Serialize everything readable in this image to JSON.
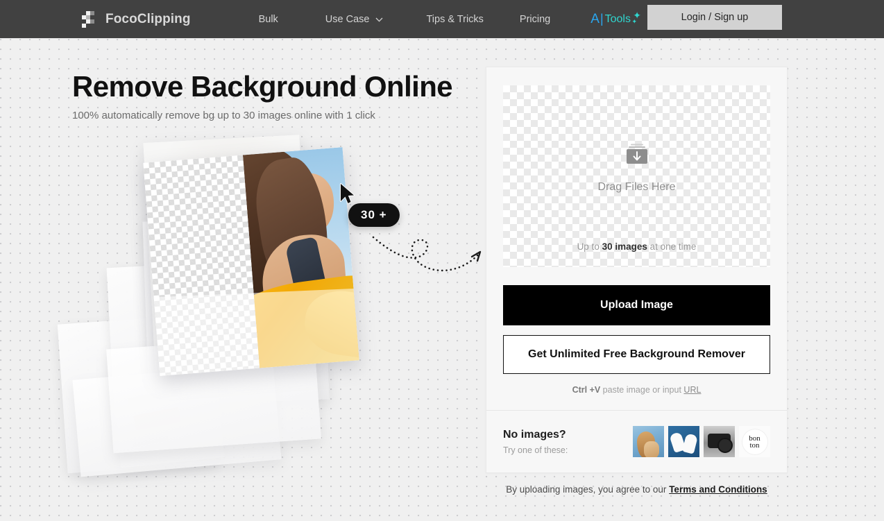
{
  "header": {
    "brand": "FocoClipping",
    "logo_icon": "checkerboard-logo-icon",
    "nav": [
      {
        "label": "Bulk",
        "icon": null
      },
      {
        "label": "Use Case",
        "icon": "chevron-down-icon"
      },
      {
        "label": "Tips & Tricks",
        "icon": null
      },
      {
        "label": "Pricing",
        "icon": null
      }
    ],
    "ai_tools": {
      "a": "A",
      "bar": "|",
      "word": "Tools",
      "spark_small": "✦",
      "spark_large": "✦"
    },
    "login_label": "Login / Sign up",
    "bar_color": "#414141",
    "accent_cyan": "#2fd6cf",
    "accent_blue": "#2aa7f0"
  },
  "hero": {
    "title": "Remove Background Online",
    "subtitle": "100% automatically remove bg up to 30 images online with 1 click",
    "badge": "30 +",
    "cursor_icon": "mouse-pointer-icon",
    "arrow_icon": "dotted-curved-arrow-icon"
  },
  "panel": {
    "dropzone": {
      "icon": "upload-tray-icon",
      "label": "Drag Files Here",
      "limit_prefix": "Up to ",
      "limit_strong": "30 images",
      "limit_suffix": " at one time"
    },
    "primary_button": "Upload Image",
    "secondary_button": "Get Unlimited Free Background Remover",
    "paste_hint": {
      "shortcut": "Ctrl +V",
      "text": " paste image or input ",
      "link": "URL"
    },
    "no_images": {
      "title": "No images?",
      "subtitle": "Try one of these:",
      "thumbs": [
        {
          "name": "sample-woman-sunglasses"
        },
        {
          "name": "sample-sneakers"
        },
        {
          "name": "sample-camera"
        },
        {
          "name": "sample-bon-ton-logo",
          "line1": "bon",
          "line2": "ton"
        }
      ]
    }
  },
  "terms": {
    "text": "By uploading images, you agree to our ",
    "link": "Terms and Conditions"
  }
}
